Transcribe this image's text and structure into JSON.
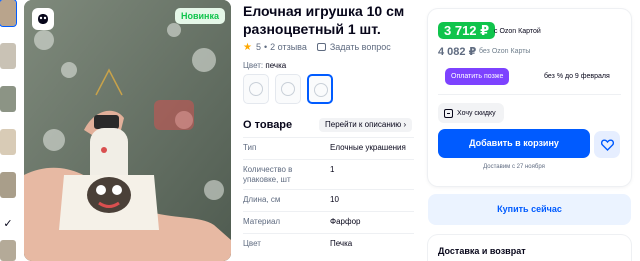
{
  "product": {
    "title": "Елочная игрушка 10 см разноцветный 1 шт.",
    "badge": "Новинка",
    "rating": "5",
    "reviews": "2 отзыва",
    "ask_question": "Задать вопрос"
  },
  "color": {
    "label": "Цвет:",
    "value": "печка"
  },
  "about": {
    "title": "О товаре",
    "link": "Перейти к описанию",
    "props": [
      {
        "key": "Тип",
        "value": "Елочные украшения"
      },
      {
        "key": "Количество в упаковке, шт",
        "value": "1"
      },
      {
        "key": "Длина, см",
        "value": "10"
      },
      {
        "key": "Материал",
        "value": "Фарфор"
      },
      {
        "key": "Цвет",
        "value": "Печка"
      }
    ]
  },
  "purchase": {
    "price_card": "3 712 ₽",
    "price_card_note": "с Ozon Картой",
    "price_regular": "4 082 ₽",
    "price_regular_note": "без Ozon Карты",
    "pay_later": "Оплатить позже",
    "pay_later_note": "без % до 9 февраля",
    "want_discount": "Хочу скидку",
    "add_to_cart": "Добавить в корзину",
    "delivery": "Доставим с 27 ноября",
    "buy_now": "Купить сейчас",
    "delivery_returns": "Доставка и возврат"
  },
  "colors": {
    "accent": "#005bff",
    "green": "#10c44c",
    "purple": "#7d42ff"
  },
  "icons": [
    "ozon-logo-icon",
    "star-icon",
    "question-icon",
    "discount-icon",
    "heart-icon",
    "chevron-right-icon",
    "chevron-down-icon"
  ]
}
